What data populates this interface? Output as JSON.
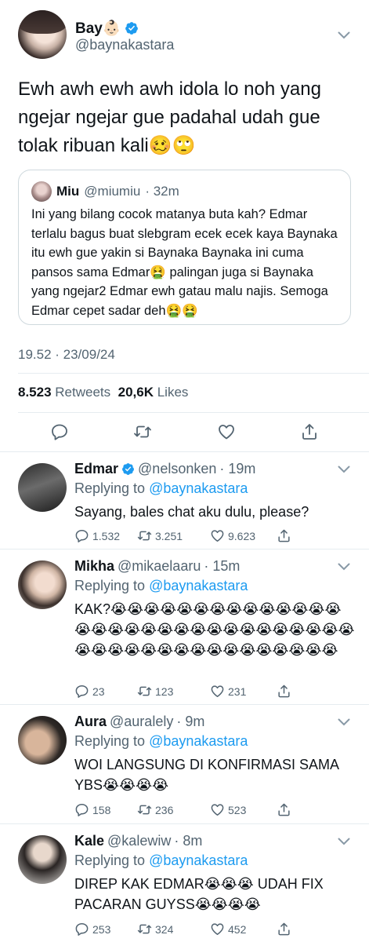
{
  "tweet": {
    "display_name": "Bay👶🏻",
    "handle": "@baynakastara",
    "text": "Ewh awh ewh awh idola lo noh yang ngejar ngejar gue padahal udah gue tolak ribuan kali🥴🙄",
    "timestamp": "19.52 · 23/09/24",
    "retweets_count": "8.523",
    "retweets_label": "Retweets",
    "likes_count": "20,6K",
    "likes_label": "Likes"
  },
  "quote": {
    "name": "Miu",
    "handle": "@miumiu",
    "time": "· 32m",
    "text": "Ini yang bilang cocok matanya buta kah? Edmar terlalu bagus buat slebgram ecek ecek kaya Baynaka itu ewh gue yakin si Baynaka Baynaka ini cuma pansos sama Edmar🤮 palingan juga si Baynaka yang ngejar2 Edmar ewh gatau malu najis. Semoga Edmar cepet sadar deh🤮🤮"
  },
  "replies": [
    {
      "name": "Edmar",
      "verified": true,
      "handle": "@nelsonken",
      "time": "· 19m",
      "replying_prefix": "Replying to",
      "replying_to": "@baynakastara",
      "text": "Sayang, bales chat aku dulu, please?",
      "replies": "1.532",
      "retweets": "3.251",
      "likes": "9.623"
    },
    {
      "name": "Mikha",
      "verified": false,
      "handle": "@mikaelaaru",
      "time": "· 15m",
      "replying_prefix": "Replying to",
      "replying_to": "@baynakastara",
      "text": "KAK?😭😭😭😭😭😭😭😭😭😭😭😭😭😭😭😭😭😭😭😭😭😭😭😭😭😭😭😭😭😭😭😭😭😭😭😭😭😭😭😭😭😭😭😭😭😭😭",
      "replies": "23",
      "retweets": "123",
      "likes": "231"
    },
    {
      "name": "Aura",
      "verified": false,
      "handle": "@auralely",
      "time": "· 9m",
      "replying_prefix": "Replying to",
      "replying_to": "@baynakastara",
      "text": "WOI LANGSUNG DI KONFIRMASI SAMA YBS😭😭😭😭",
      "replies": "158",
      "retweets": "236",
      "likes": "523"
    },
    {
      "name": "Kale",
      "verified": false,
      "handle": "@kalewiw",
      "time": "· 8m",
      "replying_prefix": "Replying to",
      "replying_to": "@baynakastara",
      "text": "DIREP KAK EDMAR😭😭😭 UDAH FIX PACARAN GUYSS😭😭😭😭",
      "replies": "253",
      "retweets": "324",
      "likes": "452"
    }
  ],
  "icons": {
    "verified": "verified-badge-icon",
    "chevron": "chevron-down-icon",
    "reply": "reply-icon",
    "retweet": "retweet-icon",
    "like": "heart-icon",
    "share": "share-icon"
  },
  "colors": {
    "accent": "#1d9bf0",
    "secondary_text": "#536471",
    "primary_text": "#0f1419",
    "border": "#cfd9de"
  }
}
